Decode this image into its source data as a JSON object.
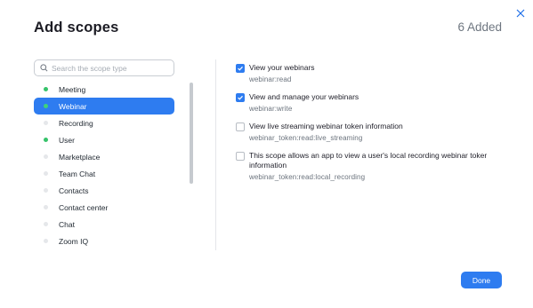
{
  "dialog": {
    "title": "Add scopes",
    "added_count": "6 Added"
  },
  "search": {
    "placeholder": "Search the scope type",
    "value": ""
  },
  "categories": [
    {
      "label": "Meeting",
      "has_selection": true
    },
    {
      "label": "Webinar",
      "has_selection": true,
      "selected": true
    },
    {
      "label": "Recording",
      "has_selection": false
    },
    {
      "label": "User",
      "has_selection": true
    },
    {
      "label": "Marketplace",
      "has_selection": false
    },
    {
      "label": "Team Chat",
      "has_selection": false
    },
    {
      "label": "Contacts",
      "has_selection": false
    },
    {
      "label": "Contact center",
      "has_selection": false
    },
    {
      "label": "Chat",
      "has_selection": false
    },
    {
      "label": "Zoom IQ",
      "has_selection": false
    }
  ],
  "scopes": [
    {
      "name": "View your webinars",
      "code": "webinar:read",
      "checked": true
    },
    {
      "name": "View and manage your webinars",
      "code": "webinar:write",
      "checked": true
    },
    {
      "name": "View live streaming webinar token information",
      "code": "webinar_token:read:live_streaming",
      "checked": false
    },
    {
      "name": "This scope allows an app to view a user's local recording webinar toker information",
      "code": "webinar_token:read:local_recording",
      "checked": false
    }
  ],
  "buttons": {
    "done": "Done"
  },
  "colors": {
    "accent": "#2e7cf0",
    "active_dot": "#36c36a",
    "inactive_dot": "#e5e7ea"
  }
}
